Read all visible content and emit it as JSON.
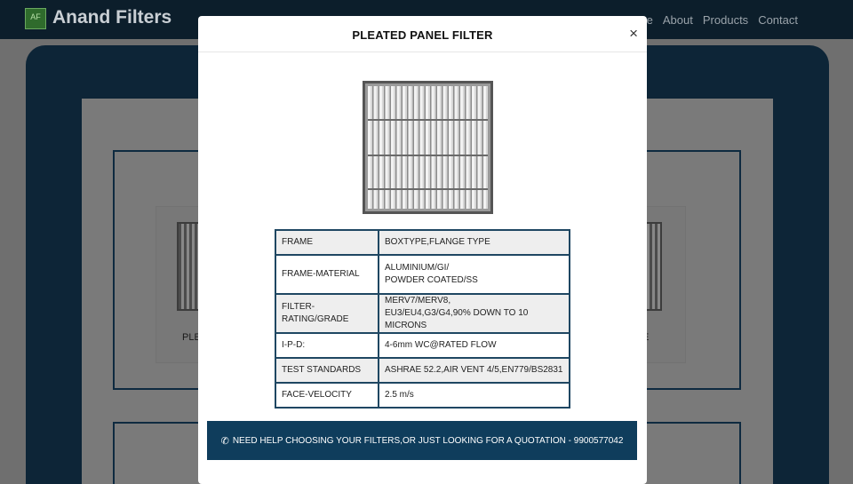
{
  "site": {
    "brand": "Anand Filters",
    "logo_text": "AF",
    "nav_links": [
      "Home",
      "About",
      "Products",
      "Contact"
    ]
  },
  "background": {
    "cards": [
      {
        "caption": "PLEA"
      },
      {
        "caption": "E"
      }
    ]
  },
  "modal": {
    "title": "PLEATED PANEL FILTER",
    "close_label": "×",
    "specs": [
      {
        "key": "FRAME",
        "value": "BOXTYPE,FLANGE TYPE"
      },
      {
        "key": "FRAME-MATERIAL",
        "value_lines": [
          "ALUMINIUM/GI/",
          "POWDER COATED/SS"
        ]
      },
      {
        "key": "FILTER-RATING/GRADE",
        "value_lines": [
          "MERV7/MERV8,",
          "EU3/EU4,G3/G4,90% DOWN TO 10 MICRONS"
        ]
      },
      {
        "key": "I-P-D:",
        "value": "4-6mm WC@RATED FLOW"
      },
      {
        "key": "TEST STANDARDS",
        "value": "ASHRAE 52.2,AIR VENT 4/5,EN779/BS2831"
      },
      {
        "key": "FACE-VELOCITY",
        "value": "2.5 m/s"
      }
    ],
    "cta_text": "NEED HELP CHOOSING YOUR FILTERS,OR JUST LOOKING FOR A QUOTATION - 9900577042",
    "cta_icon": "phone-icon"
  },
  "colors": {
    "navbar": "#0c1e2b",
    "panel": "#0d2537",
    "cta": "#0f3d5c",
    "table_border": "#1f4762"
  }
}
